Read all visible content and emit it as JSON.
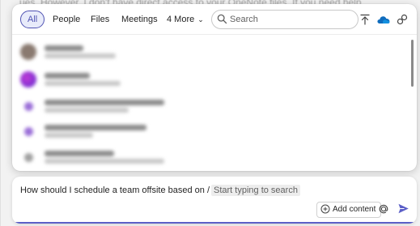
{
  "background": {
    "text": "ues. However, I don't have direct access to your OneNote files. If you need help"
  },
  "tabs": [
    {
      "label": "All",
      "active": true
    },
    {
      "label": "People",
      "active": false
    },
    {
      "label": "Files",
      "active": false
    },
    {
      "label": "Meetings",
      "active": false
    },
    {
      "label": "4 More",
      "active": false
    }
  ],
  "search": {
    "placeholder": "Search"
  },
  "toolbar_icons": [
    "upload-icon",
    "onedrive-icon",
    "share-link-icon"
  ],
  "results": [
    {
      "kind": "person",
      "color": "#8a7a70"
    },
    {
      "kind": "person",
      "color": "#7b2fd0"
    },
    {
      "kind": "item",
      "color": "#9b6fd8"
    },
    {
      "kind": "item",
      "color": "#9b6fd8"
    },
    {
      "kind": "item",
      "color": "#a0a0a0"
    }
  ],
  "compose": {
    "prompt": "How should I schedule a team offsite based on /",
    "chip": "Start typing to search",
    "add_content_label": "Add content",
    "accent": "#5b5fc7"
  }
}
